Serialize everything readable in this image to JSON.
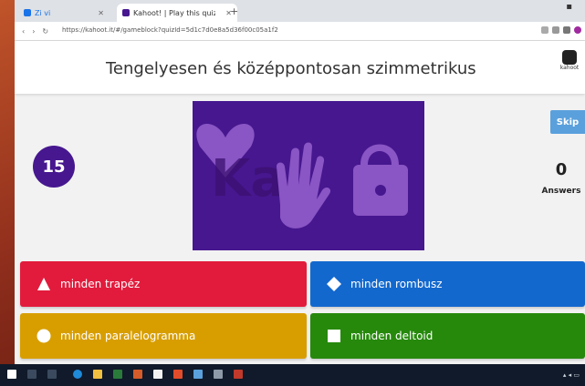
{
  "browser": {
    "tabs": [
      {
        "label": "Zi vi",
        "active": false
      },
      {
        "label": "Kahoot! | Play this quiz now!",
        "active": true
      }
    ],
    "url": "https://kahoot.it/#/gameblock?quizId=5d1c7d0e8a5d36f00c05a1f2",
    "new_tab_icon": "plus-icon"
  },
  "question": {
    "text": "Tengelyesen és középpontosan szimmetrikus"
  },
  "logo": {
    "text": "kahoot"
  },
  "timer": {
    "value": "15"
  },
  "skip": {
    "label": "Skip"
  },
  "answers_panel": {
    "count": "0",
    "label": "Answers"
  },
  "answers": [
    {
      "text": "minden trapéz",
      "shape": "triangle-icon",
      "color": "#e21b3c"
    },
    {
      "text": "minden rombusz",
      "shape": "diamond-icon",
      "color": "#1368ce"
    },
    {
      "text": "minden paralelogramma",
      "shape": "circle-icon",
      "color": "#d89e00"
    },
    {
      "text": "minden deltoid",
      "shape": "square-icon",
      "color": "#26890c"
    }
  ],
  "colors": {
    "purple": "#46178f",
    "skip_blue": "#5aa0dc",
    "taskbar": "#101a2a"
  }
}
